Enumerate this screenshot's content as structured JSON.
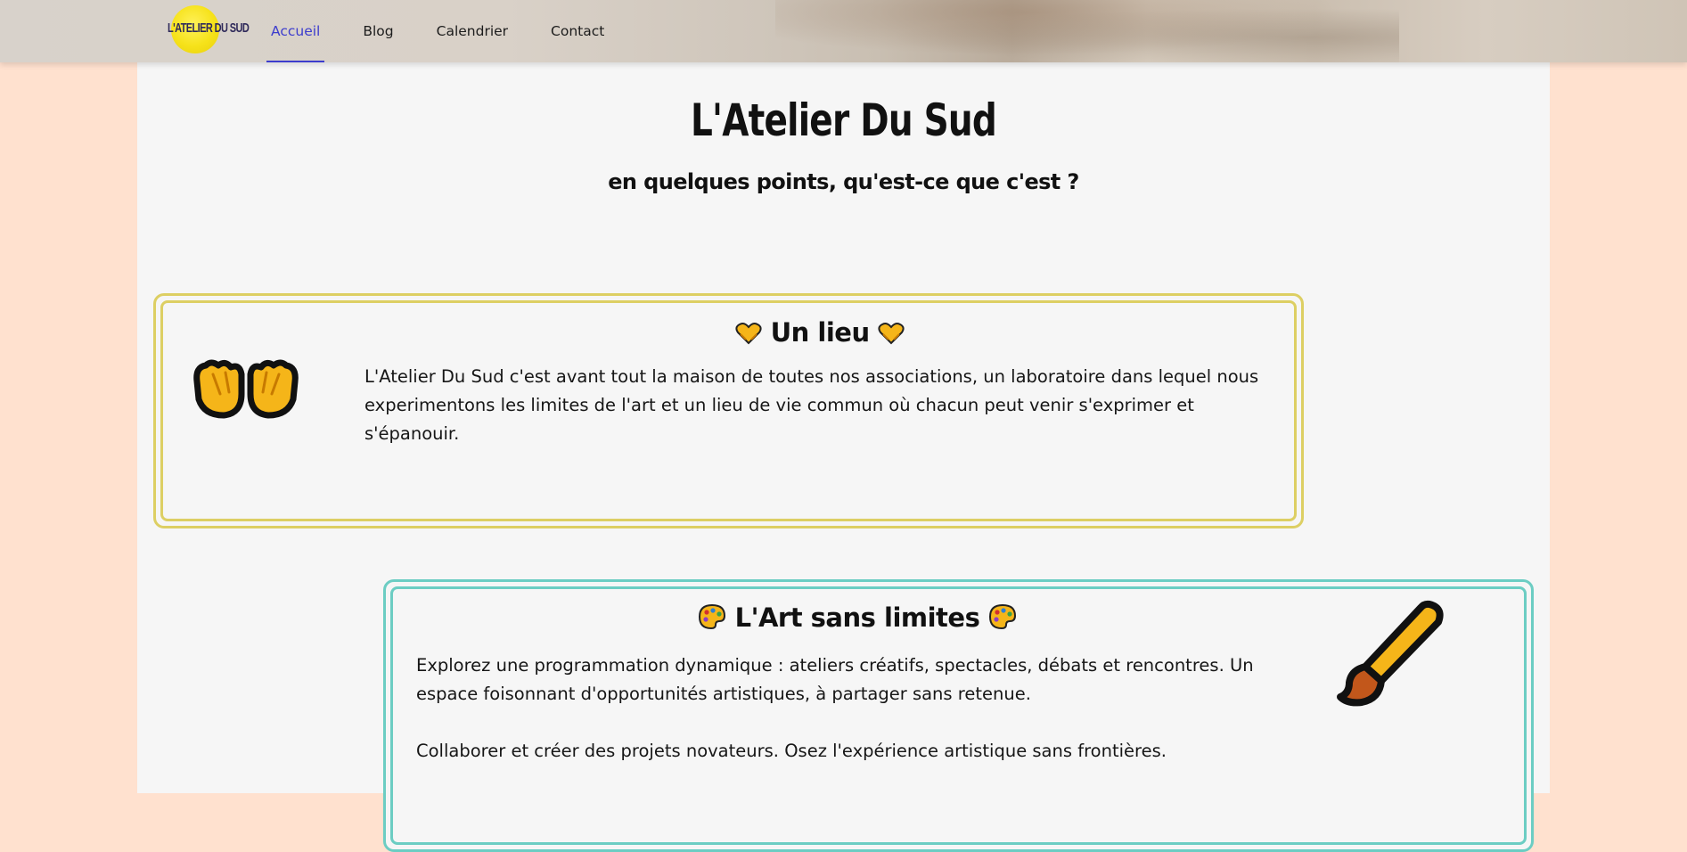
{
  "brand": {
    "logo_text": "L'ATELIER DU SUD",
    "logo_color": "#f4e11c"
  },
  "nav": {
    "items": [
      {
        "label": "Accueil",
        "active": true
      },
      {
        "label": "Blog",
        "active": false
      },
      {
        "label": "Calendrier",
        "active": false
      },
      {
        "label": "Contact",
        "active": false
      }
    ],
    "active_color": "#3c3ccd"
  },
  "hero": {
    "title": "L'Atelier Du Sud",
    "subtitle": "en quelques points, qu'est-ce que c'est ?"
  },
  "cards": [
    {
      "title": "Un lieu",
      "title_icon": "heart-hands-icon",
      "side_icon": "open-hands-icon",
      "border_color": "#ddcf63",
      "paragraphs": [
        "L'Atelier Du Sud c'est avant tout la maison de toutes nos associations, un laboratoire dans lequel nous experimentons les limites de l'art et un lieu de vie commun où chacun peut venir s'exprimer et s'épanouir."
      ]
    },
    {
      "title": "L'Art sans limites",
      "title_icon": "palette-icon",
      "side_icon": "paintbrush-icon",
      "border_color": "#6ccdc3",
      "paragraphs": [
        "Explorez une programmation dynamique : ateliers créatifs, spectacles, débats et rencontres. Un espace foisonnant d'opportunités artistiques, à partager sans retenue.",
        "Collaborer et créer des projets novateurs. Osez l'expérience artistique sans frontières."
      ]
    }
  ]
}
